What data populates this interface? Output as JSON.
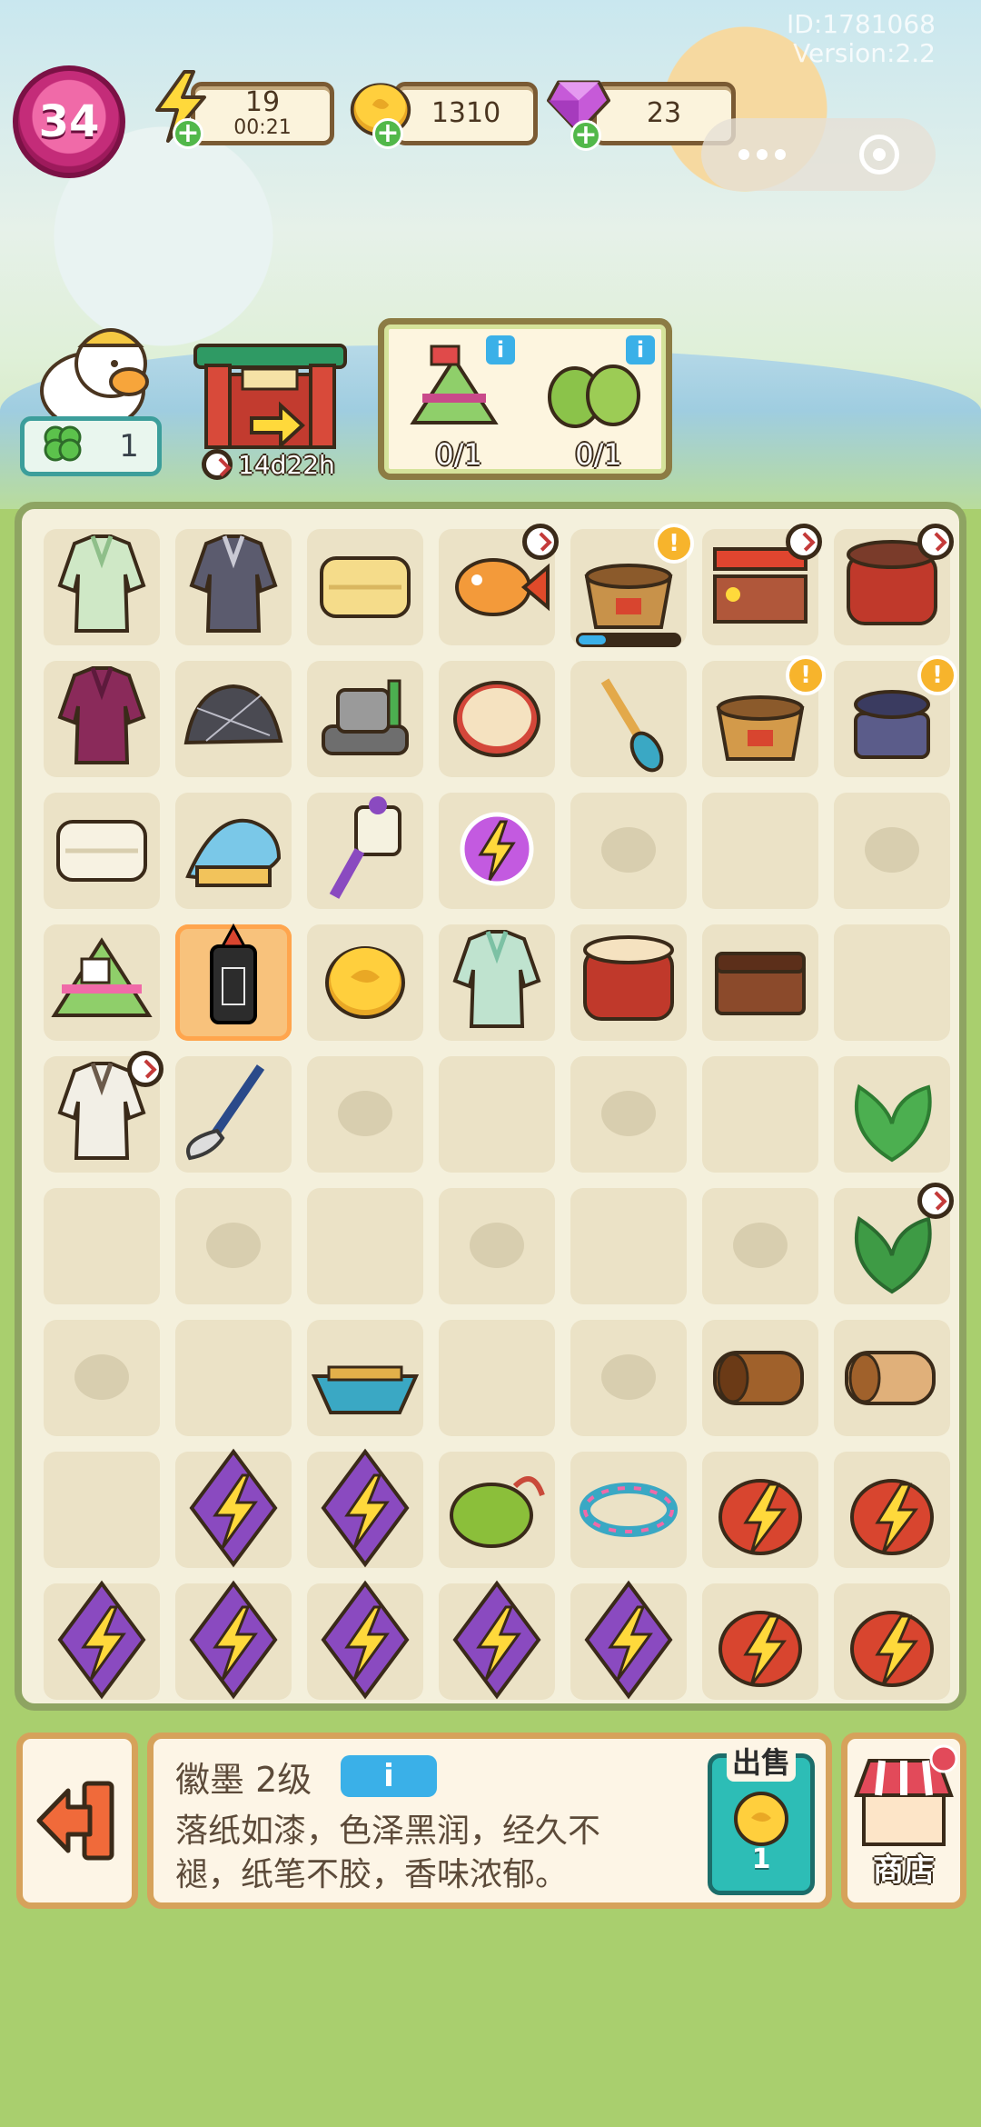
{
  "header": {
    "id_text": "ID:1781068",
    "version_text": "Version:2.2"
  },
  "player": {
    "level": "34"
  },
  "resources": {
    "energy": {
      "value": "19",
      "timer": "00:21",
      "icon": "lightning-icon"
    },
    "coins": {
      "value": "1310",
      "icon": "coin-icon"
    },
    "gems": {
      "value": "23",
      "icon": "gem-icon"
    }
  },
  "clover": {
    "count": "1"
  },
  "event": {
    "timer": "14d22h"
  },
  "orders": [
    {
      "name": "zongzi-bundle",
      "count": "0/1"
    },
    {
      "name": "green-beans",
      "count": "0/1"
    }
  ],
  "colors": {
    "board_border": "#8ea462",
    "panel_border": "#d6a25b",
    "info_blue": "#3ab0e8",
    "sell_teal": "#2dbdb6"
  },
  "board": {
    "cols": 7,
    "rows": 9,
    "cells": [
      [
        "robe-green",
        "cobweb-cloak",
        "silk-cloth",
        "koi-fish",
        "bamboo-basket",
        "dragon-stall",
        "festival-drum"
      ],
      [
        "purple-robe",
        "cobweb-stone",
        "stone-mill",
        "tambourine",
        "paddle",
        "basket-small",
        "cooking-pot"
      ],
      [
        "folded-cloth",
        "dragon-boat-head",
        "ribbon-fan",
        "energy-orb",
        "hidden",
        "empty",
        "hidden"
      ],
      [
        "zongzi",
        "hui-ink",
        "gold-coin",
        "green-hanfu",
        "war-drum",
        "wooden-chest",
        "empty"
      ],
      [
        "white-robe",
        "brush",
        "hidden",
        "empty",
        "hidden",
        "empty",
        "parsley"
      ],
      [
        "empty",
        "hidden",
        "empty",
        "hidden",
        "empty",
        "hidden",
        "zongzi-leaves"
      ],
      [
        "hidden",
        "empty",
        "small-boat",
        "empty",
        "hidden",
        "log",
        "timber"
      ],
      [
        "empty",
        "kite",
        "kite",
        "sachet",
        "braided-bracelet",
        "lantern-bag",
        "lantern-bag"
      ],
      [
        "kite",
        "kite",
        "kite",
        "kite",
        "kite",
        "lantern-bag",
        "lantern-bag"
      ]
    ],
    "selected": [
      3,
      1
    ]
  },
  "selected_item": {
    "name": "徽墨 2级",
    "info_label": "i",
    "description_line1": "落纸如漆，色泽黑润，经久不",
    "description_line2": "褪，纸笔不胶，香味浓郁。",
    "sell_label": "出售",
    "sell_price": "1"
  },
  "shop": {
    "label": "商店"
  }
}
